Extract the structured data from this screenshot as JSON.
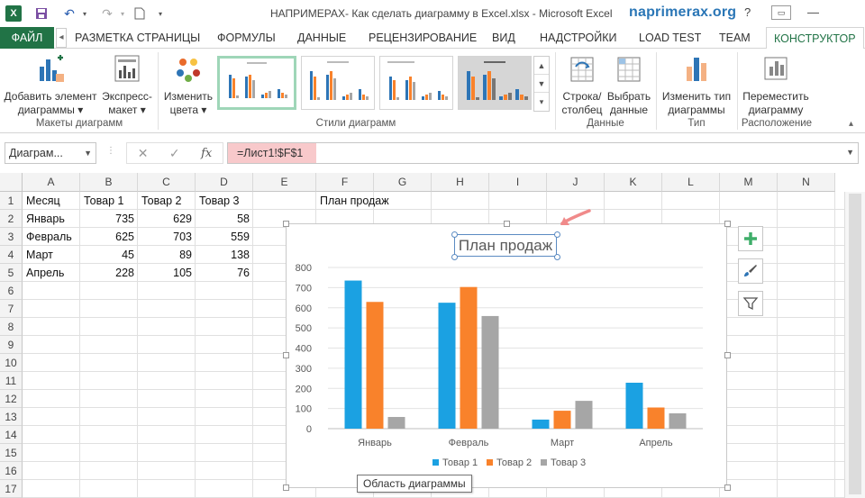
{
  "app": {
    "window_title": "НАПРИМЕРАХ- Как сделать диаграмму в Excel.xlsx - Microsoft Excel",
    "site": "naprimerax.org",
    "win_controls": [
      "?",
      "—"
    ]
  },
  "tabs": {
    "file": "ФАЙЛ",
    "items": [
      "РАЗМЕТКА СТРАНИЦЫ",
      "ФОРМУЛЫ",
      "ДАННЫЕ",
      "РЕЦЕНЗИРОВАНИЕ",
      "ВИД",
      "НАДСТРОЙКИ",
      "LOAD TEST",
      "TEAM"
    ],
    "active": "КОНСТРУКТОР"
  },
  "ribbon": {
    "add_element": [
      "Добавить элемент",
      "диаграммы ▾"
    ],
    "express_layout": [
      "Экспресс-",
      "макет ▾"
    ],
    "change_colors": [
      "Изменить",
      "цвета ▾"
    ],
    "switch_row_col": [
      "Строка/",
      "столбец"
    ],
    "select_data": [
      "Выбрать",
      "данные"
    ],
    "change_type": [
      "Изменить тип",
      "диаграммы"
    ],
    "move_chart": [
      "Переместить",
      "диаграмму"
    ],
    "groups": {
      "layouts": "Макеты диаграмм",
      "styles": "Стили диаграмм",
      "data": "Данные",
      "type": "Тип",
      "location": "Расположение"
    }
  },
  "formula_bar": {
    "name_box": "Диаграм...",
    "formula": "=Лист1!$F$1"
  },
  "grid": {
    "columns": [
      "A",
      "B",
      "C",
      "D",
      "E",
      "F",
      "G",
      "H",
      "I",
      "J",
      "K",
      "L",
      "M",
      "N"
    ],
    "rows": [
      "1",
      "2",
      "3",
      "4",
      "5",
      "6",
      "7",
      "8",
      "9",
      "10",
      "11",
      "12",
      "13",
      "14",
      "15",
      "16",
      "17"
    ],
    "cells": {
      "A1": "Месяц",
      "B1": "Товар 1",
      "C1": "Товар 2",
      "D1": "Товар 3",
      "F1": "План продаж",
      "A2": "Январь",
      "B2": "735",
      "C2": "629",
      "D2": "58",
      "A3": "Февраль",
      "B3": "625",
      "C3": "703",
      "D3": "559",
      "A4": "Март",
      "B4": "45",
      "C4": "89",
      "D4": "138",
      "A5": "Апрель",
      "B5": "228",
      "C5": "105",
      "D5": "76"
    }
  },
  "colors": {
    "excel_green": "#217346",
    "series1": "#1ba1e2",
    "series2": "#f9822b",
    "series3": "#a6a6a6",
    "formula_highlight": "#f8c9cb",
    "arrow": "#f08a8a"
  },
  "chart_data": {
    "type": "bar",
    "title": "План продаж",
    "categories": [
      "Январь",
      "Февраль",
      "Март",
      "Апрель"
    ],
    "series": [
      {
        "name": "Товар 1",
        "values": [
          735,
          625,
          45,
          228
        ]
      },
      {
        "name": "Товар 2",
        "values": [
          629,
          703,
          89,
          105
        ]
      },
      {
        "name": "Товар 3",
        "values": [
          58,
          559,
          138,
          76
        ]
      }
    ],
    "ylim": [
      0,
      800
    ],
    "yticks": [
      0,
      100,
      200,
      300,
      400,
      500,
      600,
      700,
      800
    ],
    "grid": true,
    "legend": "bottom"
  },
  "tooltip": "Область диаграммы"
}
